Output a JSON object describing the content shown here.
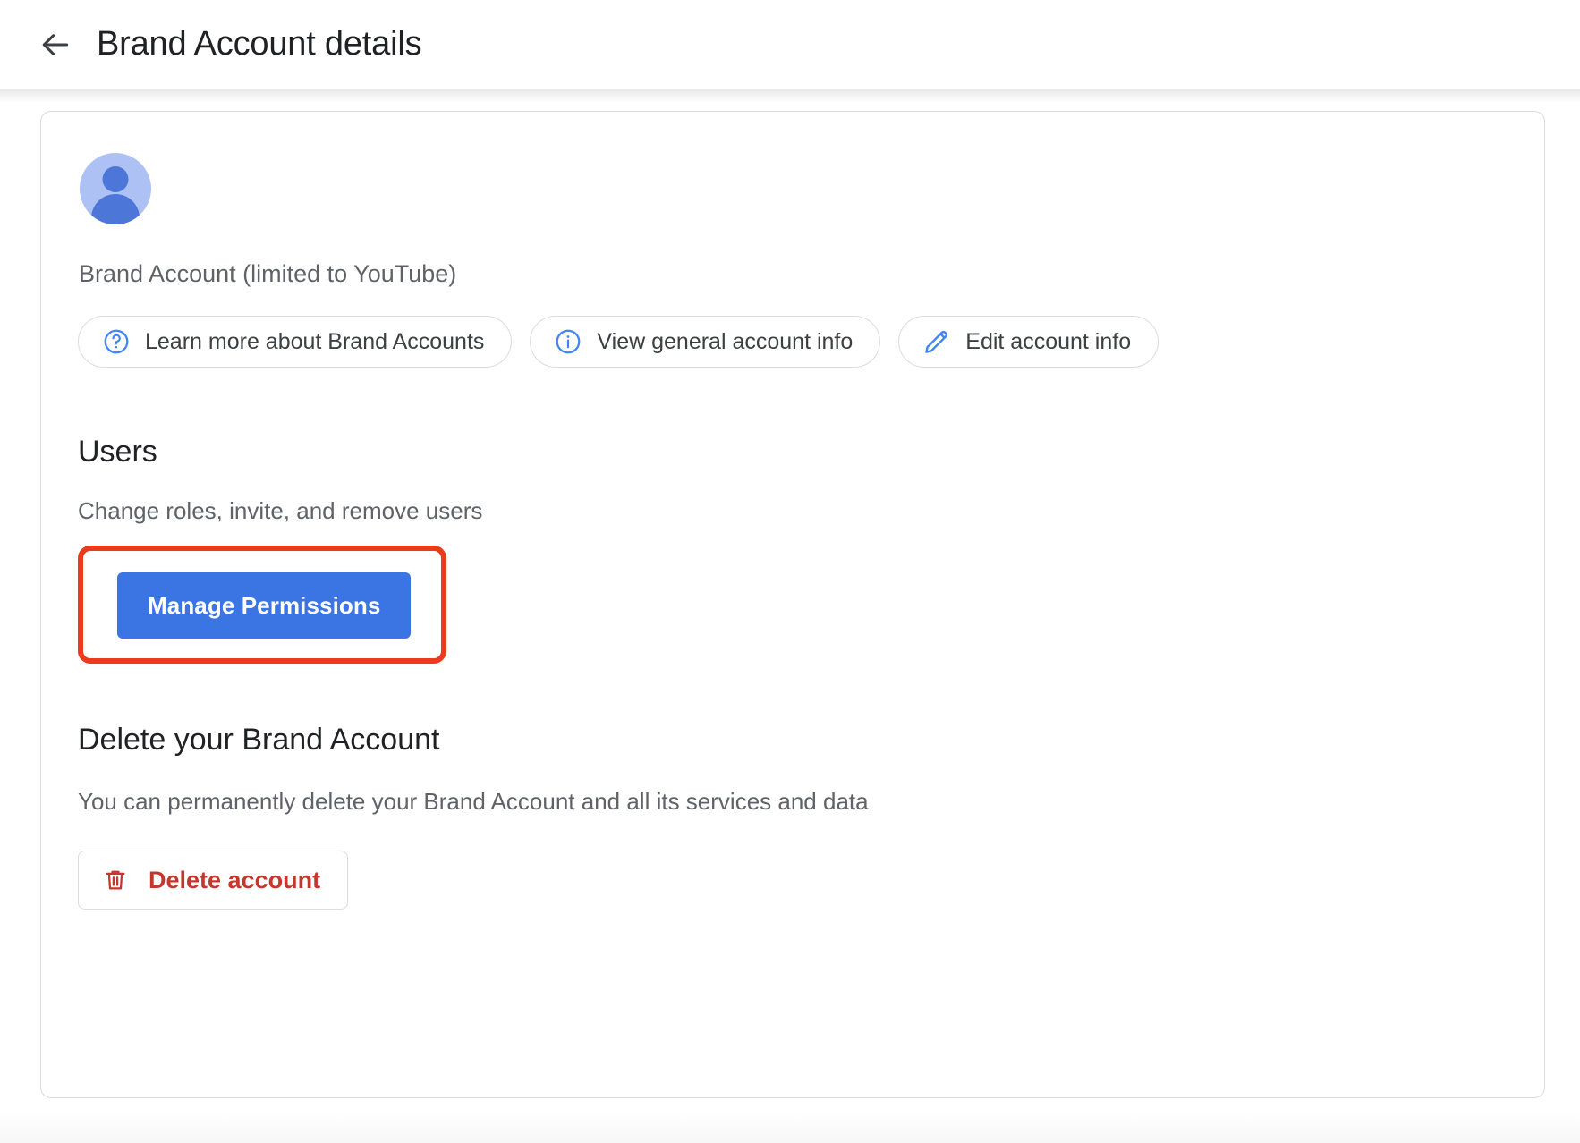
{
  "header": {
    "back_icon": "arrow-left-icon",
    "title": "Brand Account details"
  },
  "card": {
    "avatar": {
      "icon": "person-avatar-icon",
      "background_color": "#aec1f5",
      "figure_color": "#4d76d9"
    },
    "account_type": "Brand Account (limited to YouTube)",
    "chips": [
      {
        "icon": "help-circle-icon",
        "label": "Learn more about Brand Accounts"
      },
      {
        "icon": "info-circle-icon",
        "label": "View general account info"
      },
      {
        "icon": "pencil-edit-icon",
        "label": "Edit account info"
      }
    ],
    "users_section": {
      "title": "Users",
      "subtitle": "Change roles, invite, and remove users",
      "manage_button_label": "Manage Permissions",
      "manage_button_color": "#3b74e3",
      "highlight_color": "#ec3b1c"
    },
    "delete_section": {
      "title": "Delete your Brand Account",
      "subtitle": "You can permanently delete your Brand Account and all its services and data",
      "delete_button_label": "Delete account",
      "delete_button_icon": "trash-icon",
      "delete_button_color": "#c5372c"
    }
  }
}
